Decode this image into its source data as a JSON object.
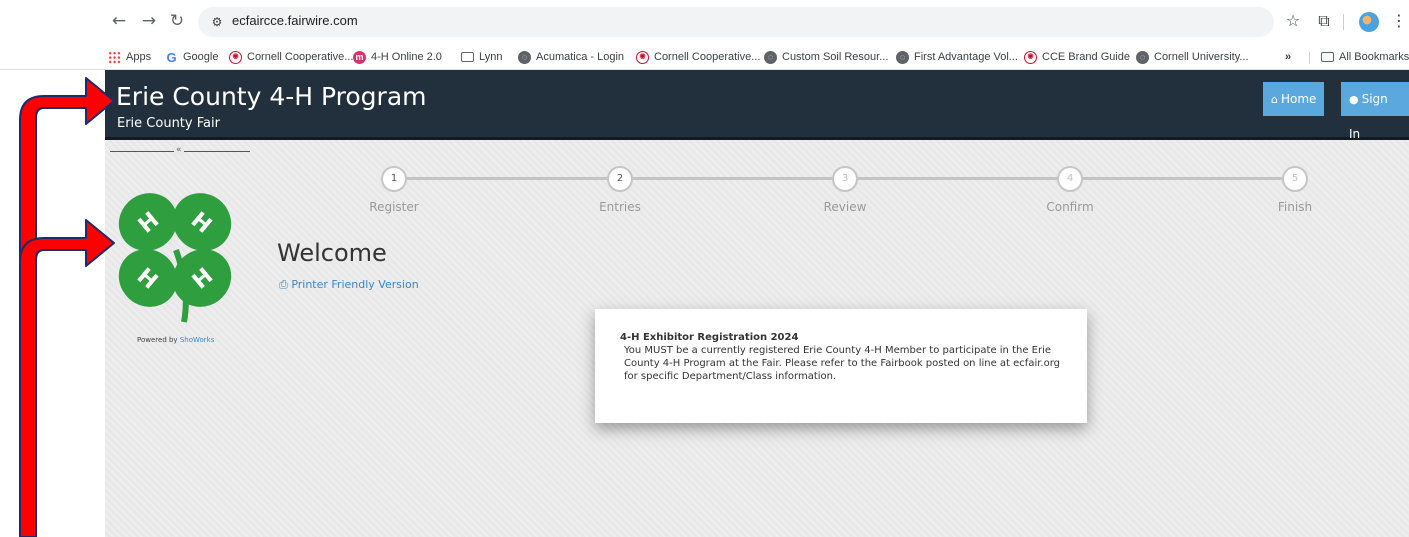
{
  "browser": {
    "url": "ecfaircce.fairwire.com",
    "bookmarks": [
      {
        "label": "Apps",
        "icon": "apps-grid-icon"
      },
      {
        "label": "Google",
        "icon": "google-icon"
      },
      {
        "label": "Cornell Cooperative...",
        "icon": "cce-icon"
      },
      {
        "label": "4-H Online 2.0",
        "icon": "4h-online-icon"
      },
      {
        "label": "Lynn",
        "icon": "folder-icon"
      },
      {
        "label": "Acumatica - Login",
        "icon": "globe-icon"
      },
      {
        "label": "Cornell Cooperative...",
        "icon": "cce-icon"
      },
      {
        "label": "Custom Soil Resour...",
        "icon": "globe-icon"
      },
      {
        "label": "First Advantage Vol...",
        "icon": "globe-icon"
      },
      {
        "label": "CCE Brand Guide",
        "icon": "cce-icon"
      },
      {
        "label": "Cornell University...",
        "icon": "globe-icon"
      }
    ],
    "overflow": "»",
    "all_bookmarks": "All Bookmarks"
  },
  "header": {
    "title": "Erie County 4-H Program",
    "subtitle": "Erie County Fair",
    "home_label": "Home",
    "signin_label": "Sign In"
  },
  "sidebar": {
    "powered_prefix": "Powered by",
    "powered_link": "ShoWorks",
    "divider_mark": "«"
  },
  "steps": [
    {
      "num": "1",
      "label": "Register"
    },
    {
      "num": "2",
      "label": "Entries"
    },
    {
      "num": "3",
      "label": "Review"
    },
    {
      "num": "4",
      "label": "Confirm"
    },
    {
      "num": "5",
      "label": "Finish"
    }
  ],
  "main": {
    "heading": "Welcome",
    "printer_link": "Printer Friendly Version",
    "notice_title": "4-H Exhibitor Registration 2024",
    "notice_body": "You MUST be a currently registered Erie County 4-H Member to participate in the Erie County 4-H Program at the Fair.  Please refer to the Fairbook posted on line at ecfair.org for specific Department/Class information."
  },
  "colors": {
    "header_bg": "#22303d",
    "accent": "#5aa8de",
    "clover": "#2e9e3e",
    "arrow": "#ff0000",
    "arrow_outline": "#1f2a6b"
  }
}
